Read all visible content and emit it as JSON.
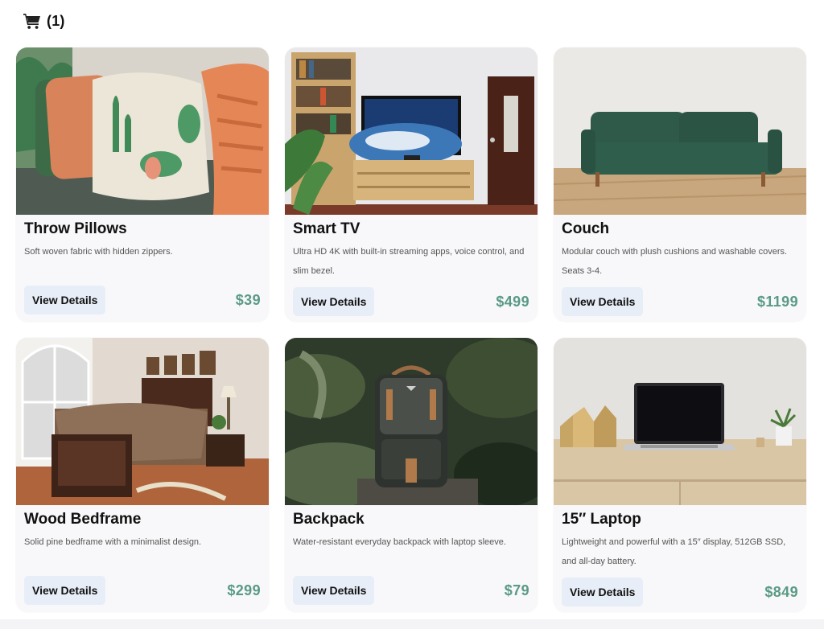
{
  "header": {
    "cart_icon": "shopping-cart-icon",
    "cart_count": "(1)"
  },
  "colors": {
    "price": "#5a9a85",
    "button_bg": "#e8eef8",
    "card_bg": "#f8f8fa"
  },
  "products": [
    {
      "title": "Throw Pillows",
      "description": "Soft woven fabric with hidden zippers.",
      "button": "View Details",
      "price": "$39"
    },
    {
      "title": "Smart TV",
      "description": "Ultra HD 4K with built-in streaming apps, voice control, and slim bezel.",
      "button": "View Details",
      "price": "$499"
    },
    {
      "title": "Couch",
      "description": "Modular couch with plush cushions and washable covers. Seats 3-4.",
      "button": "View Details",
      "price": "$1199"
    },
    {
      "title": "Wood Bedframe",
      "description": "Solid pine bedframe with a minimalist design.",
      "button": "View Details",
      "price": "$299"
    },
    {
      "title": "Backpack",
      "description": "Water-resistant everyday backpack with laptop sleeve.",
      "button": "View Details",
      "price": "$79"
    },
    {
      "title": "15″ Laptop",
      "description": "Lightweight and powerful with a 15″ display, 512GB SSD, and all-day battery.",
      "button": "View Details",
      "price": "$849"
    }
  ]
}
